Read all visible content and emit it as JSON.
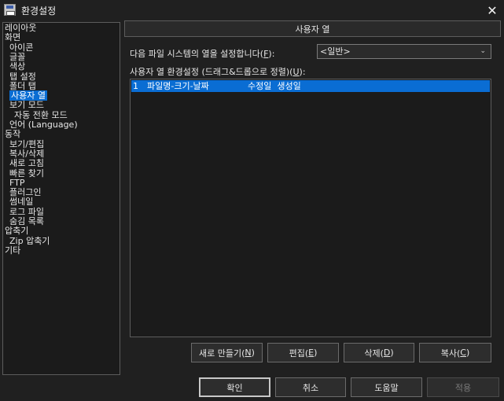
{
  "window": {
    "title": "환경설정",
    "close": "✕"
  },
  "tree": [
    {
      "label": "레이아웃",
      "indent": 0
    },
    {
      "label": "화면",
      "indent": 0
    },
    {
      "label": "아이콘",
      "indent": 1
    },
    {
      "label": "글꼴",
      "indent": 1
    },
    {
      "label": "색상",
      "indent": 1
    },
    {
      "label": "탭 설정",
      "indent": 1
    },
    {
      "label": "폴더 탭",
      "indent": 1
    },
    {
      "label": "사용자 열",
      "indent": 1,
      "selected": true
    },
    {
      "label": "보기 모드",
      "indent": 1
    },
    {
      "label": "자동 전환 모드",
      "indent": 2
    },
    {
      "label": "언어 (Language)",
      "indent": 1
    },
    {
      "label": "동작",
      "indent": 0
    },
    {
      "label": "보기/편집",
      "indent": 1
    },
    {
      "label": "복사/삭제",
      "indent": 1
    },
    {
      "label": "새로 고침",
      "indent": 1
    },
    {
      "label": "빠른 찾기",
      "indent": 1
    },
    {
      "label": "FTP",
      "indent": 1
    },
    {
      "label": "플러그인",
      "indent": 1
    },
    {
      "label": "썸네일",
      "indent": 1
    },
    {
      "label": "로그 파일",
      "indent": 1
    },
    {
      "label": "숨김 목록",
      "indent": 1
    },
    {
      "label": "압축기",
      "indent": 0
    },
    {
      "label": "Zip 압축기",
      "indent": 1
    },
    {
      "label": "기타",
      "indent": 0
    }
  ],
  "section": {
    "title": "사용자 열"
  },
  "filesystem": {
    "label_prefix": "다음 파일 시스템의 열을 설정합니다(",
    "label_key": "F",
    "label_suffix": "):",
    "selected": "<일반>"
  },
  "columns": {
    "label_prefix": "사용자 열 환경설정 (드래그&드롭으로 정렬)(",
    "label_key": "U",
    "label_suffix": "):",
    "rows": [
      {
        "index": "1",
        "columns": "파일명-크기-날짜",
        "extra": "수정일  생성일"
      }
    ]
  },
  "list_buttons": {
    "new": {
      "prefix": "새로 만들기(",
      "key": "N",
      "suffix": ")"
    },
    "edit": {
      "prefix": "편집(",
      "key": "E",
      "suffix": ")"
    },
    "delete": {
      "prefix": "삭제(",
      "key": "D",
      "suffix": ")"
    },
    "copy": {
      "prefix": "복사(",
      "key": "C",
      "suffix": ")"
    }
  },
  "dialog_buttons": {
    "ok": "확인",
    "cancel": "취소",
    "help": "도움말",
    "apply": "적용"
  },
  "colors": {
    "selection": "#0a6dd3",
    "background": "#202020"
  }
}
